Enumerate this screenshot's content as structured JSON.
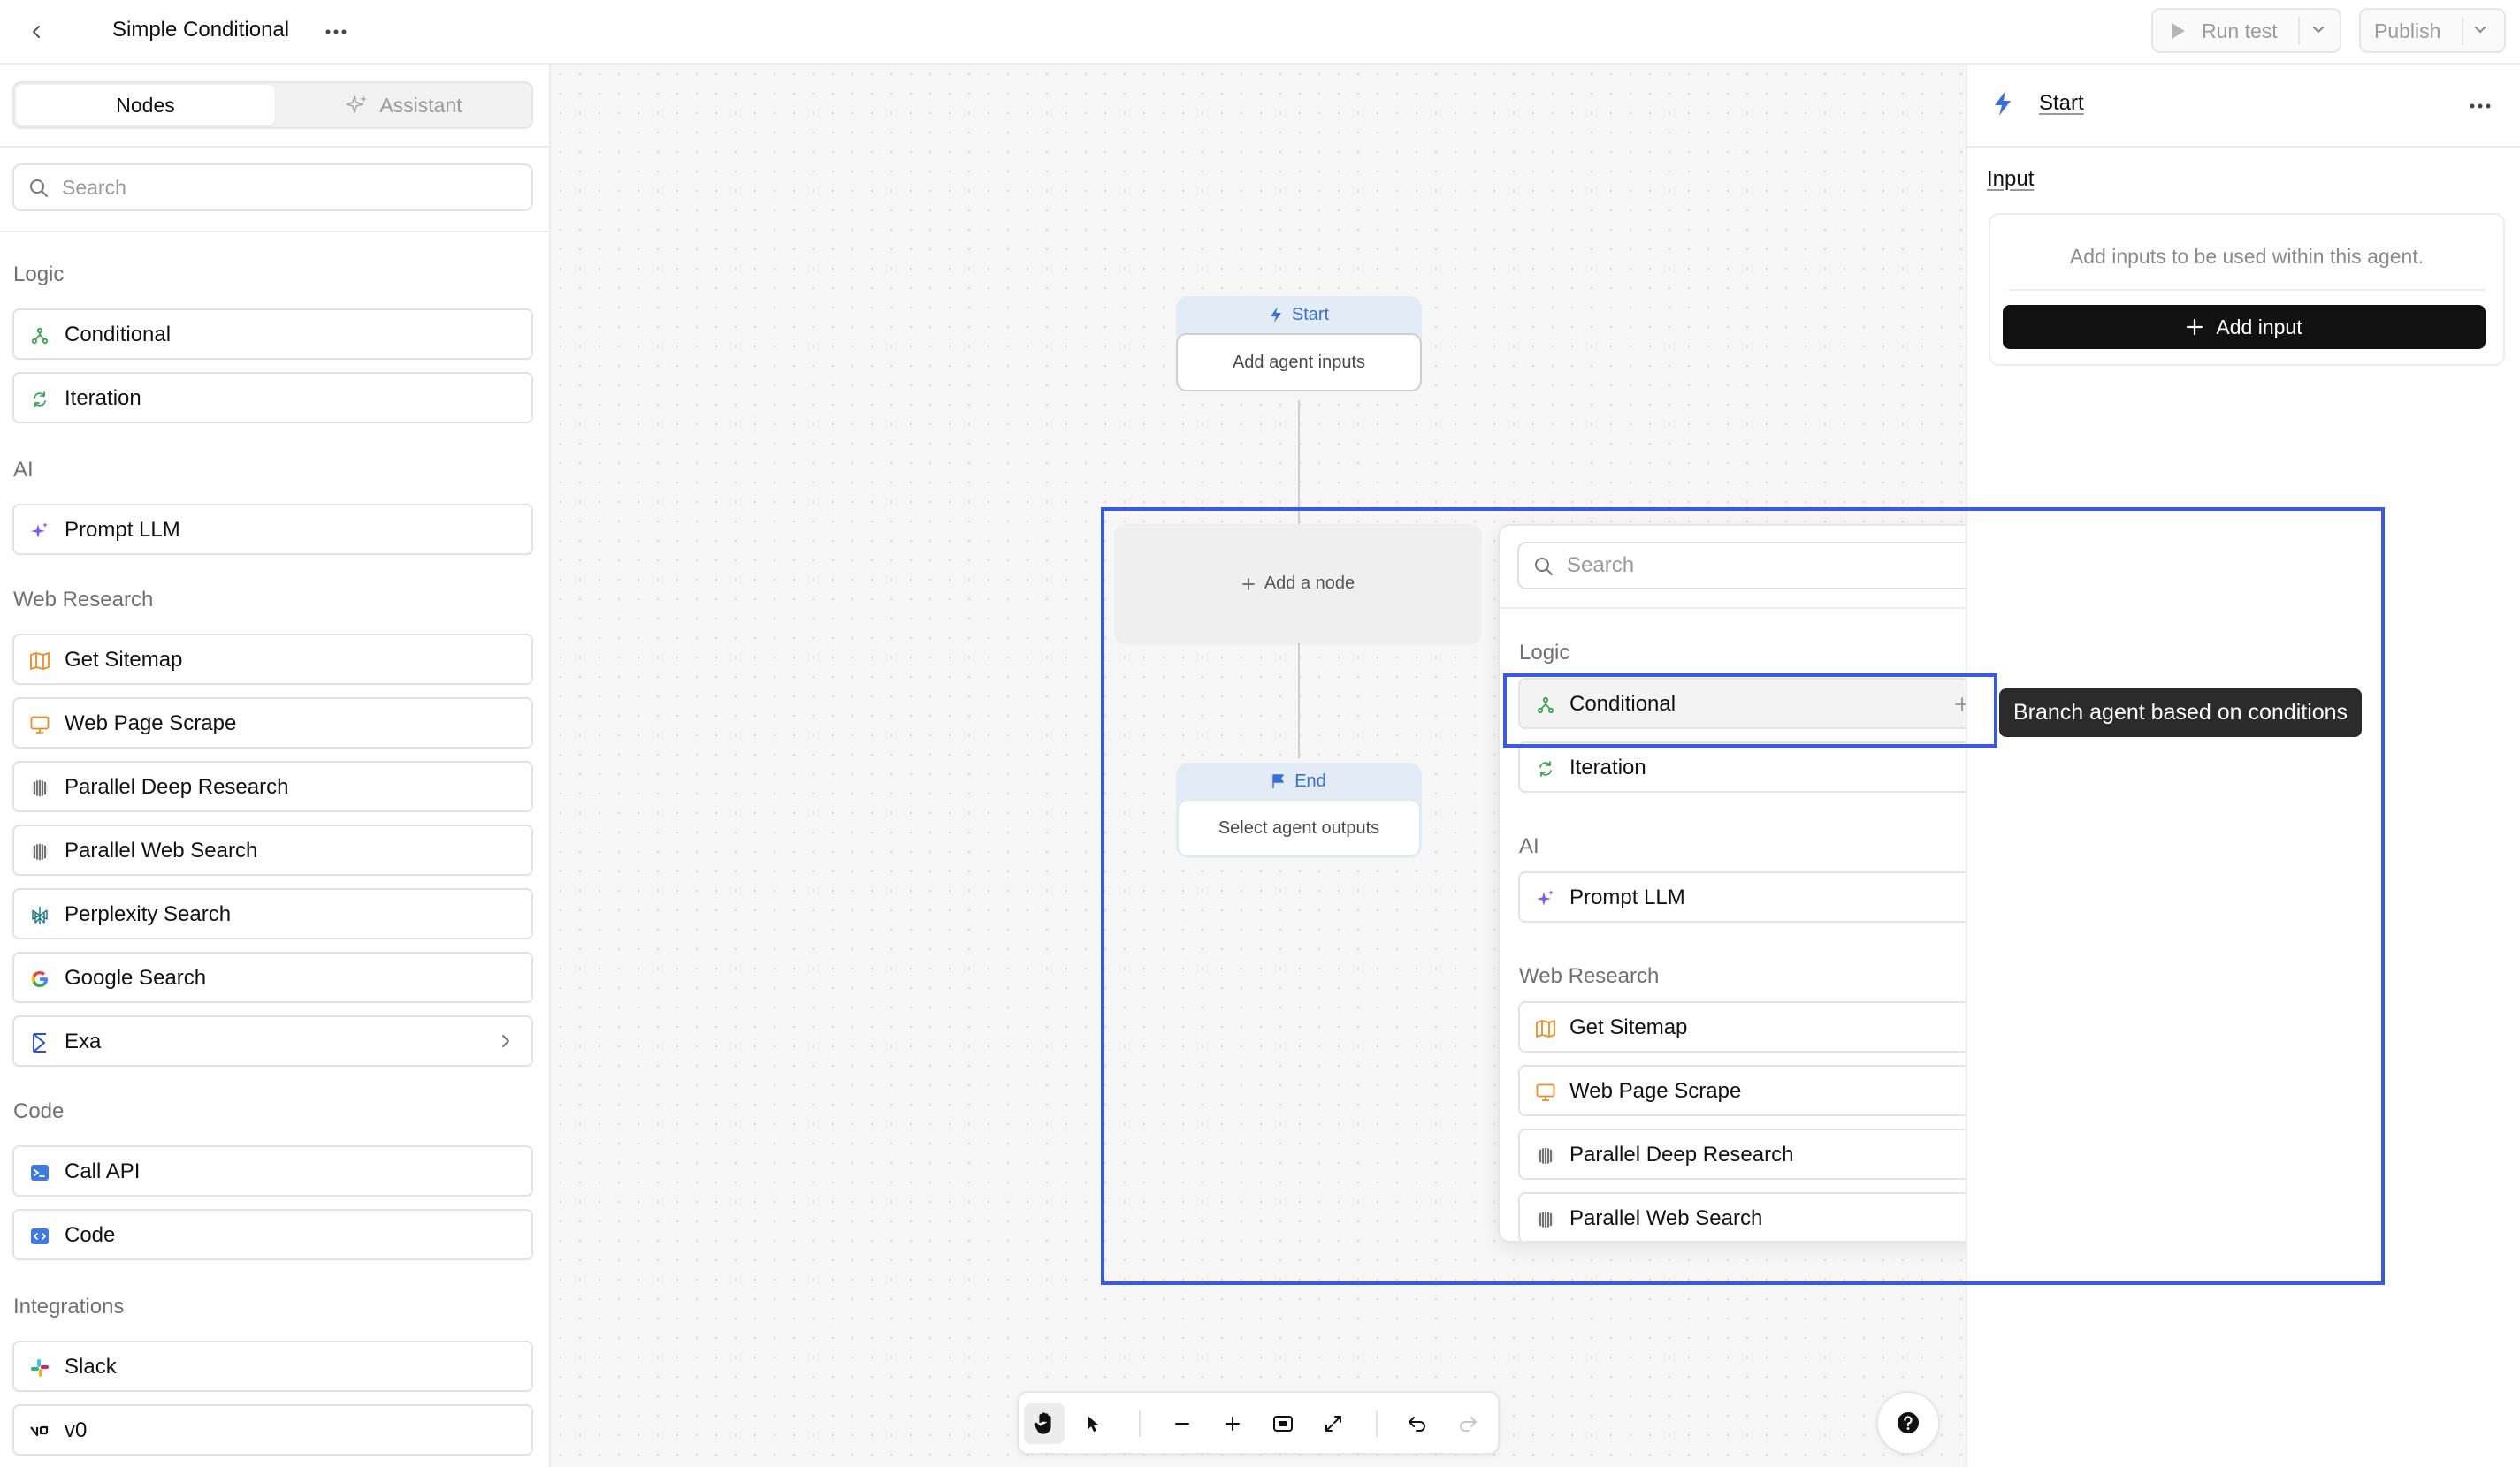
{
  "header": {
    "title": "Simple Conditional",
    "run_test_label": "Run test",
    "publish_label": "Publish"
  },
  "sidebar": {
    "tabs": [
      {
        "label": "Nodes",
        "active": true
      },
      {
        "label": "Assistant",
        "active": false
      }
    ],
    "search_placeholder": "Search",
    "sections": {
      "logic": "Logic",
      "ai": "AI",
      "web_research": "Web Research",
      "code": "Code",
      "integrations": "Integrations"
    },
    "items": {
      "conditional": {
        "label": "Conditional",
        "icon": "branch-icon"
      },
      "iteration": {
        "label": "Iteration",
        "icon": "loop-icon"
      },
      "prompt_llm": {
        "label": "Prompt LLM",
        "icon": "sparkle-icon"
      },
      "get_sitemap": {
        "label": "Get Sitemap",
        "icon": "map-icon"
      },
      "web_page_scrape": {
        "label": "Web Page Scrape",
        "icon": "monitor-icon"
      },
      "parallel_deep_research": {
        "label": "Parallel Deep Research",
        "icon": "parallel-icon"
      },
      "parallel_web_search": {
        "label": "Parallel Web Search",
        "icon": "parallel-icon"
      },
      "perplexity_search": {
        "label": "Perplexity Search",
        "icon": "perplexity-icon"
      },
      "google_search": {
        "label": "Google Search",
        "icon": "google-icon"
      },
      "exa": {
        "label": "Exa",
        "icon": "exa-icon"
      },
      "call_api": {
        "label": "Call API",
        "icon": "terminal-icon"
      },
      "code": {
        "label": "Code",
        "icon": "code-icon"
      },
      "slack": {
        "label": "Slack",
        "icon": "slack-icon"
      },
      "v0": {
        "label": "v0",
        "icon": "v0-icon"
      }
    }
  },
  "canvas": {
    "start_node": {
      "header": "Start",
      "body": "Add agent inputs"
    },
    "add_node_label": "Add a node",
    "end_node": {
      "header": "End",
      "body": "Select agent outputs"
    },
    "popup": {
      "search_placeholder": "Search",
      "sections": {
        "logic": "Logic",
        "ai": "AI",
        "web_research": "Web Research"
      },
      "items": {
        "conditional": "Conditional",
        "iteration": "Iteration",
        "prompt_llm": "Prompt LLM",
        "get_sitemap": "Get Sitemap",
        "web_page_scrape": "Web Page Scrape",
        "parallel_deep_research": "Parallel Deep Research",
        "parallel_web_search": "Parallel Web Search"
      }
    },
    "tooltip": "Branch agent based on conditions"
  },
  "right_panel": {
    "title": "Start",
    "input_label": "Input",
    "hint": "Add inputs to be used within this agent.",
    "add_input_label": "Add input"
  },
  "colors": {
    "accent_blue": "#3b6fd4",
    "highlight": "#3b5bdb",
    "green_icon": "#3aa655",
    "purple_icon": "#7c5cf0",
    "orange_icon": "#f08a24"
  }
}
